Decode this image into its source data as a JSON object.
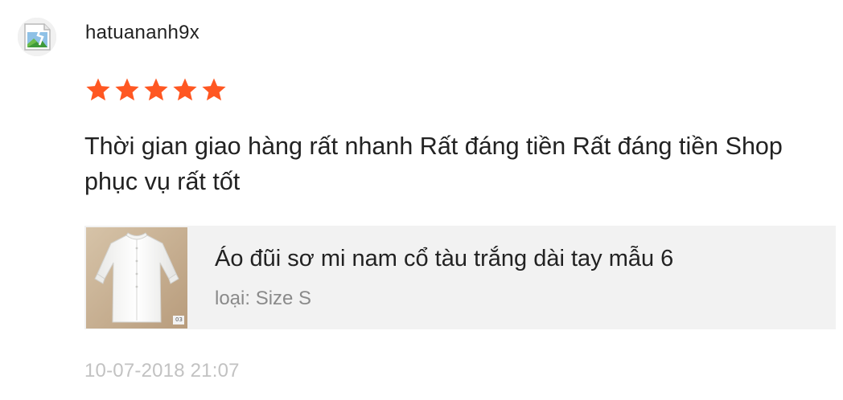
{
  "review": {
    "username": "hatuananh9x",
    "avatar_icon": "broken-image-icon",
    "rating": {
      "value": 5,
      "max": 5,
      "star_color": "#ff5722"
    },
    "comment": "Thời gian giao hàng rất nhanh Rất đáng tiền Rất đáng tiền Shop phục vụ rất tốt",
    "product": {
      "name": "Áo đũi sơ mi nam cổ tàu trắng dài tay mẫu 6",
      "variant": "loại: Size S",
      "thumb_badge": "03"
    },
    "timestamp": "10-07-2018 21:07"
  }
}
